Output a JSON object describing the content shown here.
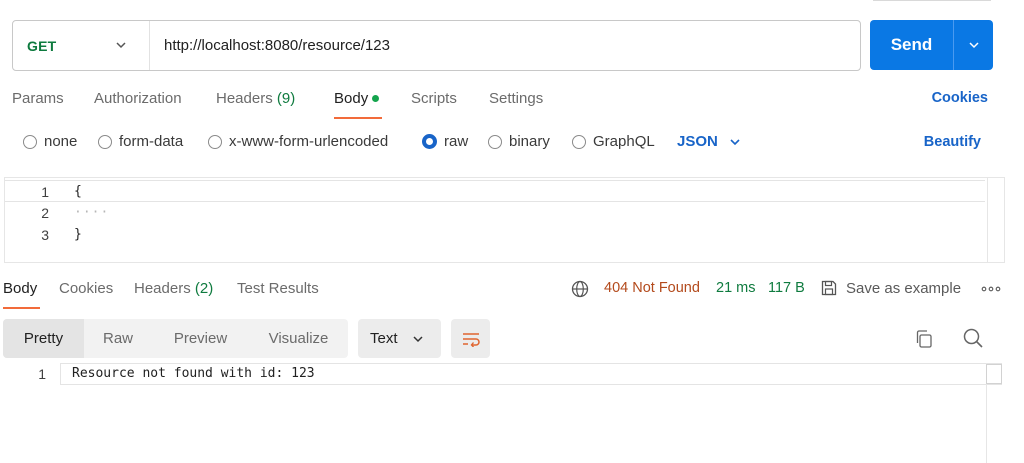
{
  "request": {
    "method": "GET",
    "url": "http://localhost:8080/resource/123",
    "send_label": "Send"
  },
  "request_tabs": {
    "params": "Params",
    "authorization": "Authorization",
    "headers": "Headers",
    "headers_count": "(9)",
    "body": "Body",
    "scripts": "Scripts",
    "settings": "Settings",
    "cookies": "Cookies"
  },
  "body_types": {
    "none": "none",
    "form_data": "form-data",
    "urlencoded": "x-www-form-urlencoded",
    "raw": "raw",
    "binary": "binary",
    "graphql": "GraphQL",
    "format": "JSON",
    "beautify": "Beautify",
    "selected": "raw"
  },
  "editor": {
    "lines": [
      {
        "num": "1",
        "code": "{"
      },
      {
        "num": "2",
        "code": "····"
      },
      {
        "num": "3",
        "code": "}"
      }
    ]
  },
  "response_tabs": {
    "body": "Body",
    "cookies": "Cookies",
    "headers": "Headers",
    "headers_count": "(2)",
    "test_results": "Test Results"
  },
  "response_status": {
    "status": "404 Not Found",
    "time": "21 ms",
    "size": "117 B",
    "save_example": "Save as example"
  },
  "response_toolbar": {
    "pretty": "Pretty",
    "raw": "Raw",
    "preview": "Preview",
    "visualize": "Visualize",
    "format": "Text"
  },
  "response_body": {
    "lines": [
      {
        "num": "1",
        "code": "Resource not found with id: 123"
      }
    ]
  },
  "colors": {
    "accent": "#0a78e4",
    "active_tab_underline": "#f26b3a",
    "method_get": "#0d7a3e",
    "status_error": "#b34a1c",
    "status_ok": "#0f7b3f",
    "link": "#1864c8"
  }
}
